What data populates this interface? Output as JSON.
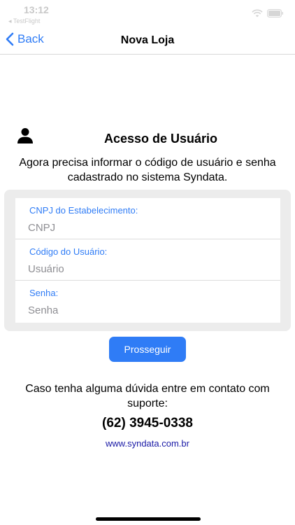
{
  "status_bar": {
    "time": "13:12",
    "carrier": "◂ TestFlight"
  },
  "nav": {
    "back_label": "Back",
    "title": "Nova Loja"
  },
  "header": {
    "icon": "user-icon",
    "title": "Acesso de Usuário"
  },
  "intro": "Agora precisa informar o código de usuário e senha cadastrado no sistema Syndata.",
  "form": {
    "fields": [
      {
        "label": "CNPJ do Estabelecimento:",
        "placeholder": "CNPJ",
        "value": ""
      },
      {
        "label": "Código do Usuário:",
        "placeholder": "Usuário",
        "value": ""
      },
      {
        "label": "Senha:",
        "placeholder": "Senha",
        "value": ""
      }
    ],
    "submit_label": "Prosseguir"
  },
  "support": {
    "text": "Caso tenha alguma dúvida entre em contato com suporte:",
    "phone": "(62) 3945-0338",
    "website": "www.syndata.com.br"
  },
  "colors": {
    "accent": "#2f7cf6",
    "link": "#1a1aa6",
    "form_background": "#ececec"
  }
}
